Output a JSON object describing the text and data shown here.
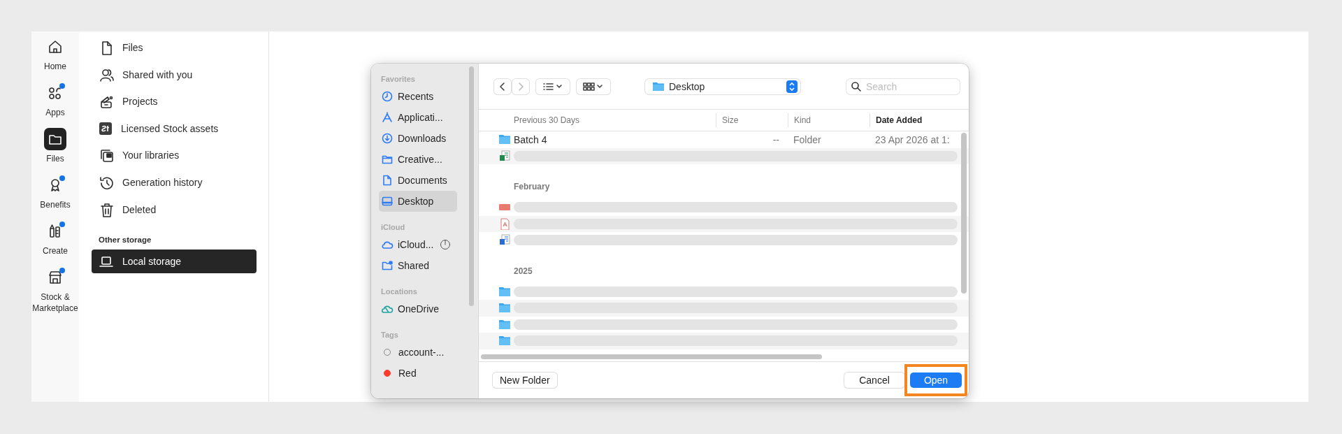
{
  "rail": [
    {
      "label": "Home",
      "selected": false,
      "badge": false
    },
    {
      "label": "Apps",
      "selected": false,
      "badge": true
    },
    {
      "label": "Files",
      "selected": true,
      "badge": false
    },
    {
      "label": "Benefits",
      "selected": false,
      "badge": true
    },
    {
      "label": "Create",
      "selected": false,
      "badge": true
    },
    {
      "label": "Stock & Marketplace",
      "selected": false,
      "badge": true
    }
  ],
  "sidebar": {
    "items": [
      {
        "label": "Files",
        "selected": false
      },
      {
        "label": "Shared with you",
        "selected": false
      },
      {
        "label": "Projects",
        "selected": false
      },
      {
        "label": "Licensed Stock assets",
        "selected": false
      },
      {
        "label": "Your libraries",
        "selected": false
      },
      {
        "label": "Generation history",
        "selected": false
      },
      {
        "label": "Deleted",
        "selected": false
      }
    ],
    "other_storage": {
      "heading": "Other storage",
      "items": [
        {
          "label": "Local storage",
          "selected": true
        }
      ]
    }
  },
  "dialog": {
    "sidebar": [
      {
        "heading": "Favorites",
        "items": [
          {
            "label": "Recents",
            "selected": false
          },
          {
            "label": "Applicati...",
            "selected": false
          },
          {
            "label": "Downloads",
            "selected": false
          },
          {
            "label": "Creative...",
            "selected": false
          },
          {
            "label": "Documents",
            "selected": false
          },
          {
            "label": "Desktop",
            "selected": true
          }
        ]
      },
      {
        "heading": "iCloud",
        "items": [
          {
            "label": "iCloud...",
            "selected": false
          },
          {
            "label": "Shared",
            "selected": false
          }
        ]
      },
      {
        "heading": "Locations",
        "items": [
          {
            "label": "OneDrive",
            "selected": false
          }
        ]
      },
      {
        "heading": "Tags",
        "items": [
          {
            "label": "account-...",
            "selected": false,
            "kind": "tag"
          },
          {
            "label": "Red",
            "selected": false,
            "kind": "tag",
            "color": "#ff3b30"
          }
        ]
      }
    ],
    "location": "Desktop",
    "search": {
      "placeholder": "Search"
    },
    "columns": [
      {
        "label": "Previous 30 Days",
        "sorted": false
      },
      {
        "label": "Size",
        "sorted": false
      },
      {
        "label": "Kind",
        "sorted": false
      },
      {
        "label": "Date Added",
        "sorted": true
      }
    ],
    "groups": [
      {
        "rows": [
          {
            "kind": "folder",
            "redacted": false,
            "name": "Batch 4",
            "size": "--",
            "type": "Folder",
            "date": "23 Apr 2026 at 1:"
          },
          {
            "kind": "sheet",
            "redacted": true
          }
        ]
      },
      {
        "label": "February",
        "rows": [
          {
            "kind": "slides",
            "redacted": true
          },
          {
            "kind": "pdf",
            "redacted": true
          },
          {
            "kind": "doc",
            "redacted": true
          }
        ]
      },
      {
        "label": "2025",
        "rows": [
          {
            "kind": "folder",
            "redacted": true
          },
          {
            "kind": "folder",
            "redacted": true
          },
          {
            "kind": "folder",
            "redacted": true
          },
          {
            "kind": "folder",
            "redacted": true
          }
        ]
      }
    ],
    "buttons": [
      {
        "label": "New Folder",
        "kind": "plain",
        "highlighted": false
      },
      {
        "label": "Cancel",
        "kind": "plain",
        "highlighted": false
      },
      {
        "label": "Open",
        "kind": "default",
        "highlighted": true
      }
    ]
  }
}
